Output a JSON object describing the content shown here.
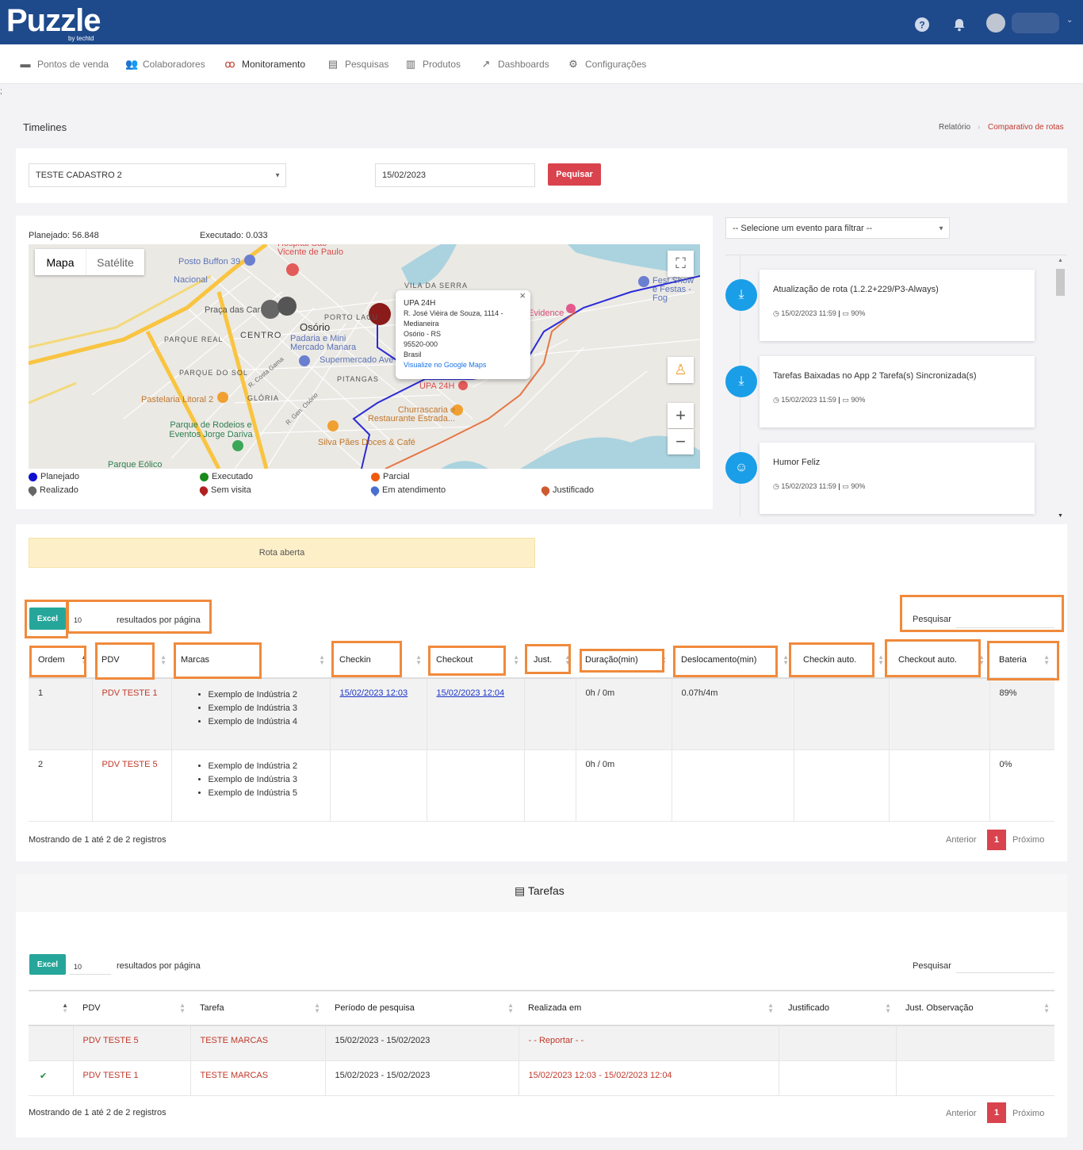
{
  "app": {
    "logo": "Puzzle",
    "logo_sub": "by techtd"
  },
  "nav": [
    {
      "label": "Pontos de venda",
      "icon": "store-icon"
    },
    {
      "label": "Colaboradores",
      "icon": "users-icon"
    },
    {
      "label": "Monitoramento",
      "icon": "monitor-icon"
    },
    {
      "label": "Pesquisas",
      "icon": "survey-icon"
    },
    {
      "label": "Produtos",
      "icon": "barcode-icon"
    },
    {
      "label": "Dashboards",
      "icon": "chart-icon"
    },
    {
      "label": "Configurações",
      "icon": "gears-icon"
    }
  ],
  "page": {
    "title": "Timelines",
    "breadcrumb_1": "Relatório",
    "breadcrumb_2": "Comparativo de rotas",
    "stray": ";"
  },
  "filters": {
    "collaborator": "TESTE CADASTRO 2",
    "date": "15/02/2023",
    "search_button": "Pequisar"
  },
  "map": {
    "planned": "Planejado: 56.848",
    "executed": "Executado: 0.033",
    "tab_map": "Mapa",
    "tab_satellite": "Satélite",
    "labels": [
      "Posto Buffon 39",
      "Nacional",
      "Praça das Car",
      "Osório",
      "CENTRO",
      "PARQUE REAL",
      "PARQUE DO SOL",
      "GLÓRIA",
      "Pastelaria Litoral 2",
      "Parque de Rodeios e Eventos Jorge Dariva",
      "Parque Eólico",
      "Padaria e Mini Mercado Manara",
      "Supermercado Ave",
      "PITANGAS",
      "UPA 24H",
      "Churrascaria e Restaurante Estrada...",
      "Silva Pães Doces & Café",
      "VILA DA SERRA",
      "PORTO LACU",
      "Evidence",
      "Hospital São Vicente de Paulo",
      "Fest Show e Festas - Fog",
      "R. Costa Gama",
      "R. Gen. Osório"
    ],
    "popup": {
      "title": "UPA 24H",
      "line1": "R. José Vièira de Souza, 1114 -",
      "line2": "Medianeira",
      "line3": "Osório - RS",
      "line4": "95520-000",
      "line5": "Brasil",
      "link": "Visualize no Google Maps"
    },
    "close": "×"
  },
  "legend": {
    "planned": "Planejado",
    "executed": "Executado",
    "partial": "Parcial",
    "done": "Realizado",
    "no_visit": "Sem visita",
    "in_service": "Em atendimento",
    "justified": "Justificado"
  },
  "event_filter": {
    "placeholder": "-- Selecione um evento para filtrar --"
  },
  "timeline": [
    {
      "title": "Atualização de rota (1.2.2+229/P3-Always)",
      "time": "15/02/2023 11:59",
      "battery": "90%",
      "icon": "download-icon"
    },
    {
      "title": "Tarefas Baixadas no App 2 Tarefa(s) Sincronizada(s)",
      "time": "15/02/2023 11:59",
      "battery": "90%",
      "icon": "download-icon"
    },
    {
      "title": "Humor Feliz",
      "time": "15/02/2023 11:59",
      "battery": "90%",
      "icon": "mask-icon"
    }
  ],
  "route_status": "Rota aberta",
  "table1": {
    "excel": "Excel",
    "per_page": "10",
    "per_page_label": "resultados por página",
    "search_label": "Pesquisar",
    "headers": [
      "Ordem",
      "PDV",
      "Marcas",
      "Checkin",
      "Checkout",
      "Just.",
      "Duração(min)",
      "Deslocamento(min)",
      "Checkin auto.",
      "Checkout auto.",
      "Bateria"
    ],
    "rows": [
      {
        "ordem": "1",
        "pdv": "PDV TESTE 1",
        "marcas": [
          "Exemplo de Indústria 2",
          "Exemplo de Indústria 3",
          "Exemplo de Indústria 4"
        ],
        "checkin": "15/02/2023 12:03",
        "checkout": "15/02/2023 12:04",
        "just": "",
        "duracao": "0h / 0m",
        "deslocamento": "0.07h/4m",
        "checkin_auto": "",
        "checkout_auto": "",
        "bateria": "89%"
      },
      {
        "ordem": "2",
        "pdv": "PDV TESTE 5",
        "marcas": [
          "Exemplo de Indústria 2",
          "Exemplo de Indústria 3",
          "Exemplo de Indústria 5"
        ],
        "checkin": "",
        "checkout": "",
        "just": "",
        "duracao": "0h / 0m",
        "deslocamento": "",
        "checkin_auto": "",
        "checkout_auto": "",
        "bateria": "0%"
      }
    ],
    "info": "Mostrando de 1 até 2 de 2 registros",
    "prev": "Anterior",
    "page": "1",
    "next": "Próximo"
  },
  "tasks": {
    "title": "Tarefas",
    "excel": "Excel",
    "per_page": "10",
    "per_page_label": "resultados por página",
    "search_label": "Pesquisar",
    "headers": [
      "",
      "PDV",
      "Tarefa",
      "Período de pesquisa",
      "Realizada em",
      "Justificado",
      "Just. Observação"
    ],
    "rows": [
      {
        "check": "",
        "pdv": "PDV TESTE 5",
        "tarefa": "TESTE MARCAS",
        "periodo": "15/02/2023 - 15/02/2023",
        "realizada": "- - Reportar - -",
        "justificado": "",
        "obs": ""
      },
      {
        "check": "✔",
        "pdv": "PDV TESTE 1",
        "tarefa": "TESTE MARCAS",
        "periodo": "15/02/2023 - 15/02/2023",
        "realizada": "15/02/2023 12:03 - 15/02/2023 12:04",
        "justificado": "",
        "obs": ""
      }
    ],
    "info": "Mostrando de 1 até 2 de 2 registros",
    "prev": "Anterior",
    "page": "1",
    "next": "Próximo"
  }
}
